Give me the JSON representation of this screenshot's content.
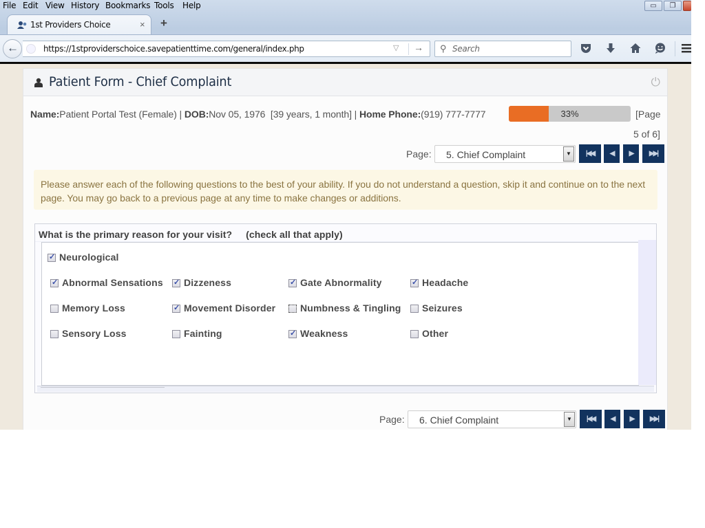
{
  "browser": {
    "menu": [
      "File",
      "Edit",
      "View",
      "History",
      "Bookmarks",
      "Tools",
      "Help"
    ],
    "menu_accel": [
      "F",
      "E",
      "V",
      "s",
      "B",
      "T",
      "H"
    ],
    "tab": {
      "title": "1st Providers Choice",
      "close_glyph": "×"
    },
    "new_tab_glyph": "+",
    "url": "https://1stproviderschoice.savepatienttime.com/general/index.php",
    "search_placeholder": "Search",
    "toolbar_icons": [
      "pocket-icon",
      "download-icon",
      "home-icon",
      "hello-chat-icon",
      "hamburger-menu-icon"
    ]
  },
  "panel": {
    "title": "Patient Form - Chief Complaint",
    "patient": {
      "name_label": "Name:",
      "name": "Patient Portal Test (Female)",
      "dob_label": "DOB:",
      "dob": "Nov 05, 1976  [39 years, 1 month]",
      "phone_label": "Home Phone:",
      "phone": "(919) 777-7777",
      "separator": " | "
    },
    "progress": {
      "percent": 33,
      "label": "33%"
    },
    "page_count_line1": "[Page",
    "page_count_line2": "5 of 6]",
    "pager_top": {
      "label": "Page:",
      "selected": "5. Chief Complaint"
    },
    "pager_bottom": {
      "label": "Page:",
      "selected": "6. Chief Complaint"
    },
    "pager_buttons": [
      "first-page",
      "previous-page",
      "next-page",
      "last-page"
    ],
    "pager_glyphs": [
      "|◀◀",
      "◀",
      "▶",
      "▶▶|"
    ],
    "notice": "Please answer each of the following questions to the best of your ability. If you do not understand a question, skip it and continue on to the next page. You may go back to a previous page at any time to make changes or additions.",
    "question": {
      "title": "What is the primary reason for your visit?     (check all that apply)",
      "category": {
        "label": "Neurological",
        "checked": true
      },
      "options": [
        {
          "label": "Abnormal Sensations",
          "checked": true
        },
        {
          "label": "Dizzeness",
          "checked": true
        },
        {
          "label": "Gate Abnormality",
          "checked": true
        },
        {
          "label": "Headache",
          "checked": true
        },
        {
          "label": "Memory Loss",
          "checked": false
        },
        {
          "label": "Movement Disorder",
          "checked": true
        },
        {
          "label": "Numbness & Tingling",
          "checked": false,
          "focused": true
        },
        {
          "label": "Seizures",
          "checked": false
        },
        {
          "label": "Sensory Loss",
          "checked": false
        },
        {
          "label": "Fainting",
          "checked": false
        },
        {
          "label": "Weakness",
          "checked": true
        },
        {
          "label": "Other",
          "checked": false
        }
      ]
    }
  }
}
